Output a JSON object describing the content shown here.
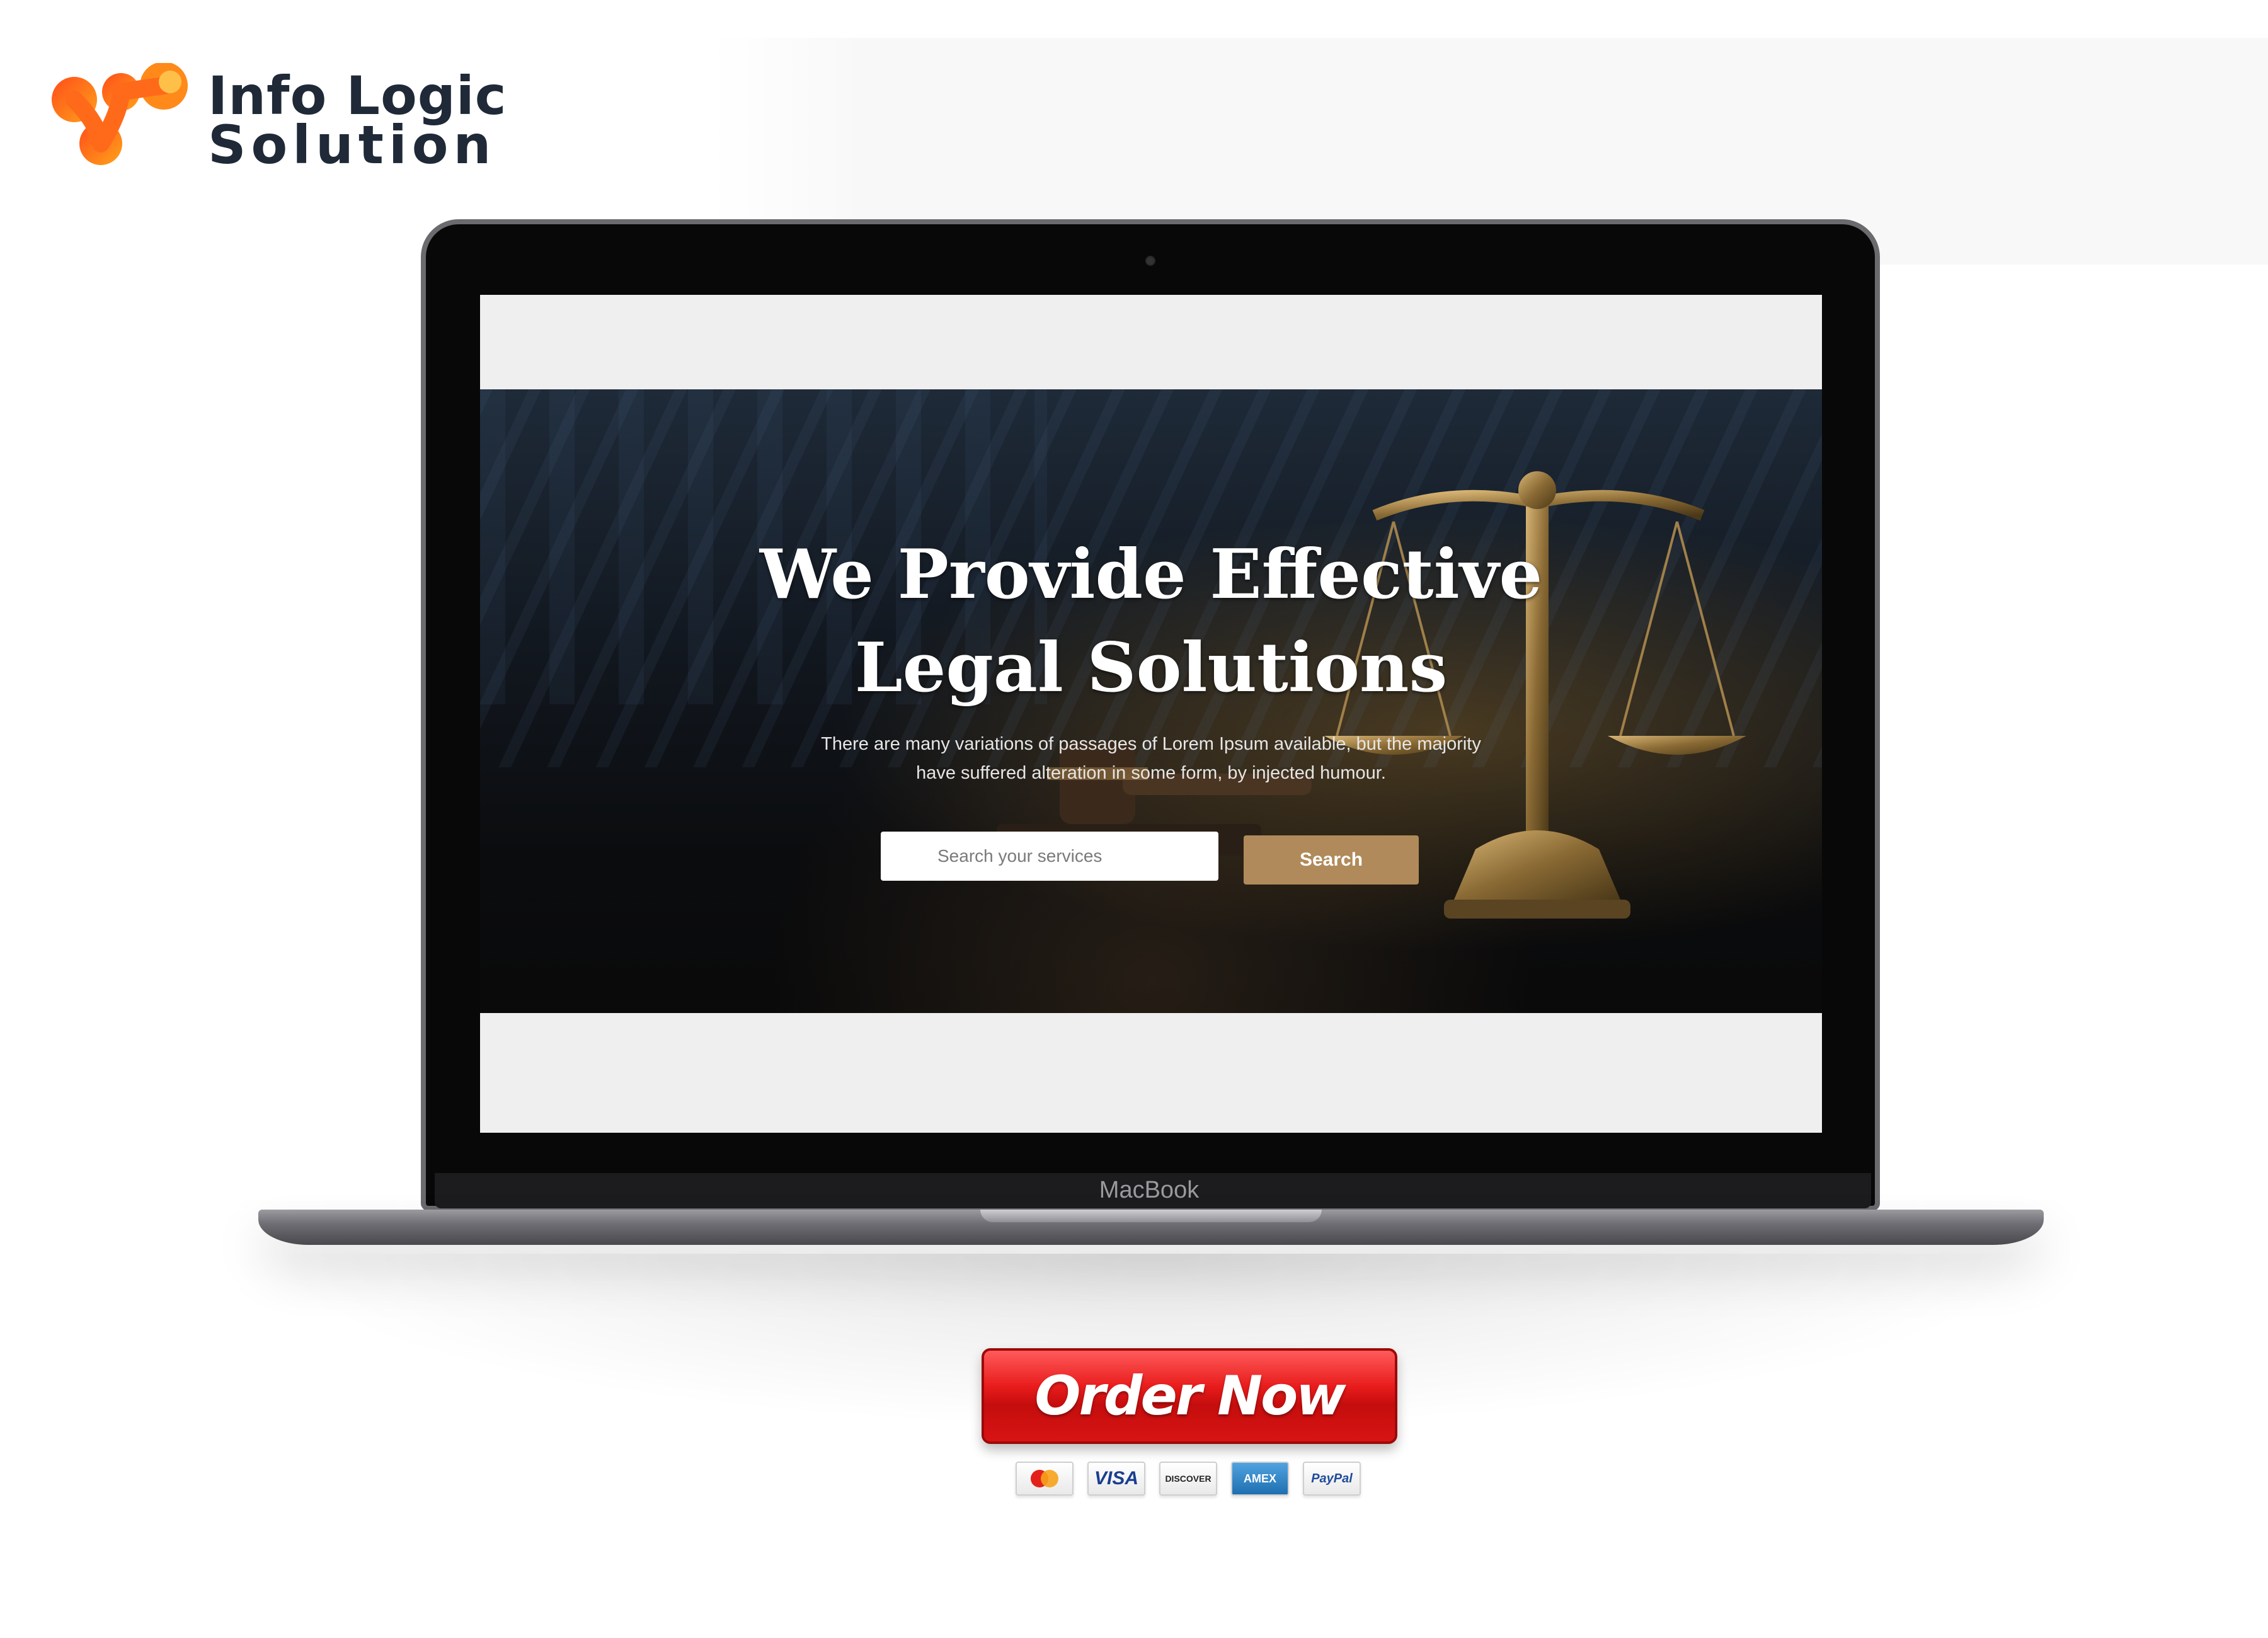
{
  "brand": {
    "line1": "Info Logic",
    "line2": "Solution",
    "colors": [
      "#ff4d1a",
      "#ff9a1a"
    ]
  },
  "laptop": {
    "label": "MacBook"
  },
  "hero": {
    "title_line1": "We Provide Effective",
    "title_line2": "Legal Solutions",
    "subtitle_line1": "There are many variations of passages of Lorem Ipsum available, but the majority",
    "subtitle_line2": "have suffered alteration in some form, by injected humour.",
    "search_placeholder": "Search your services",
    "search_button": "Search",
    "accent_color": "#b08a5a"
  },
  "order": {
    "label": "Order Now"
  },
  "payments": {
    "methods": [
      {
        "name": "mastercard-icon",
        "label": ""
      },
      {
        "name": "visa-icon",
        "label": "VISA"
      },
      {
        "name": "discover-icon",
        "label": "DISCOVER"
      },
      {
        "name": "amex-icon",
        "label": "AMEX"
      },
      {
        "name": "paypal-icon",
        "label": "PayPal"
      }
    ]
  }
}
